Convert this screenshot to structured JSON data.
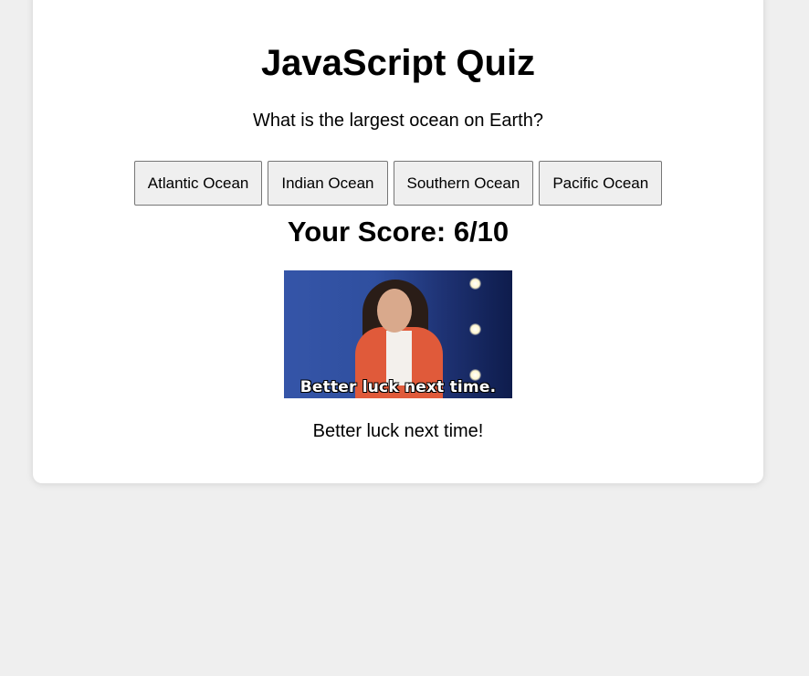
{
  "quiz": {
    "title": "JavaScript Quiz",
    "question": "What is the largest ocean on Earth?",
    "answers": [
      "Atlantic Ocean",
      "Indian Ocean",
      "Southern Ocean",
      "Pacific Ocean"
    ],
    "score_text": "Your Score: 6/10",
    "result_image": {
      "caption": "Better luck next time."
    },
    "feedback": "Better luck next time!"
  },
  "colors": {
    "page_background": "#efefef",
    "card_background": "#ffffff",
    "button_background": "#efefef",
    "button_border": "#767676"
  }
}
